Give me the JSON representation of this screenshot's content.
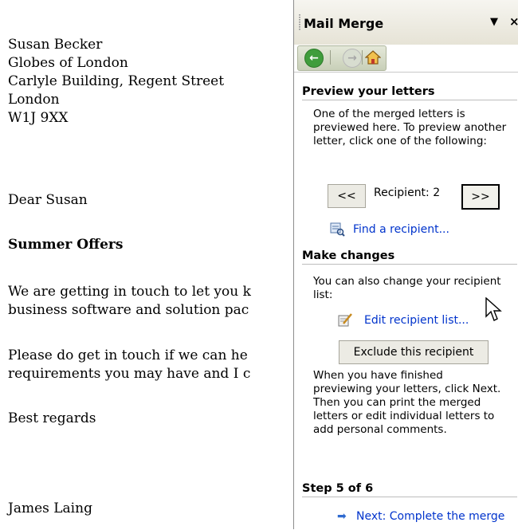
{
  "document": {
    "address_lines": [
      "Susan Becker",
      "Globes of London",
      "Carlyle Building, Regent Street",
      "London",
      "W1J 9XX"
    ],
    "salutation": "Dear Susan",
    "heading": "Summer Offers",
    "paragraph1_lines": [
      "We are getting in touch to let you k",
      "business software and solution pac"
    ],
    "paragraph2_lines": [
      "Please do get in touch if we can he",
      "requirements you may have and I c"
    ],
    "closing": "Best regards",
    "signature": "James Laing"
  },
  "task_pane": {
    "title": "Mail Merge",
    "dropdown_glyph": "▼",
    "close_glyph": "×",
    "nav": {
      "back_icon": "back-arrow-icon",
      "forward_icon": "forward-arrow-icon",
      "home_icon": "home-icon"
    },
    "preview_section": {
      "heading": "Preview your letters",
      "text": "One of the merged letters is previewed here. To preview another letter, click one of the following:",
      "prev_button": "<<",
      "recipient_label": "Recipient: 2",
      "next_button": ">>",
      "find_link": "Find a recipient..."
    },
    "changes_section": {
      "heading": "Make changes",
      "text": "You can also change your recipient list:",
      "edit_link": "Edit recipient list...",
      "exclude_button": "Exclude this recipient",
      "finish_text": "When you have finished previewing your letters, click Next. Then you can print the merged letters or edit individual letters to add personal comments."
    },
    "step": {
      "heading": "Step 5 of 6",
      "next_link": "Next: Complete the merge"
    }
  }
}
